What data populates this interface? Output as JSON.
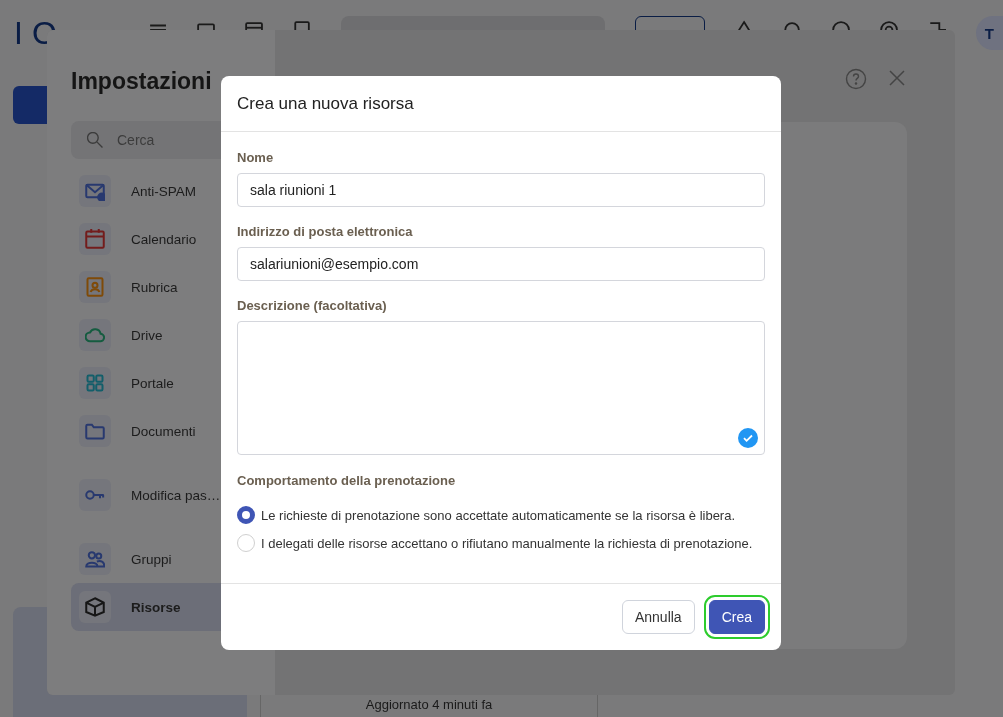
{
  "app": {
    "logo": "IO",
    "avatar": "T",
    "status": "Aggiornato 4 minuti fa"
  },
  "settings": {
    "title": "Impostazioni",
    "search": {
      "placeholder": "Cerca"
    },
    "groups": [
      {
        "items": [
          {
            "label": "Anti-SPAM",
            "color": "#28396f",
            "selected": false
          },
          {
            "label": "Calendario",
            "color": "#731c1c",
            "selected": false
          },
          {
            "label": "Rubrica",
            "color": "#7f4a08",
            "selected": false
          },
          {
            "label": "Drive",
            "color": "#155c40",
            "selected": false
          },
          {
            "label": "Portale",
            "color": "#135e6a",
            "selected": false
          },
          {
            "label": "Documenti",
            "color": "#28396f",
            "selected": false
          }
        ]
      },
      {
        "items": [
          {
            "label": "Modifica pas…",
            "color": "#28396f",
            "selected": false
          }
        ]
      },
      {
        "items": [
          {
            "label": "Gruppi",
            "color": "#28396f",
            "selected": false
          },
          {
            "label": "Risorse",
            "color": "#161616",
            "selected": true
          }
        ]
      }
    ]
  },
  "dialog": {
    "title": "Crea una nuova risorsa",
    "fields": [
      {
        "kind": "input",
        "label": "Nome",
        "value": "sala riunioni 1"
      },
      {
        "kind": "input",
        "label": "Indirizzo di posta elettronica",
        "value": "salariunioni@esempio.com"
      },
      {
        "kind": "textarea",
        "label": "Descrizione (facoltativa)"
      }
    ],
    "booking": {
      "label": "Comportamento della prenotazione",
      "options": [
        {
          "label": "Le richieste di prenotazione sono accettate automaticamente se la risorsa è libera.",
          "selected": true
        },
        {
          "label": "I delegati delle risorse accettano o rifiutano manualmente la richiesta di prenotazione.",
          "selected": false
        }
      ]
    },
    "buttons": [
      {
        "label": "Annulla",
        "primary": false,
        "highlighted": false
      },
      {
        "label": "Crea",
        "primary": true,
        "highlighted": true
      }
    ]
  }
}
